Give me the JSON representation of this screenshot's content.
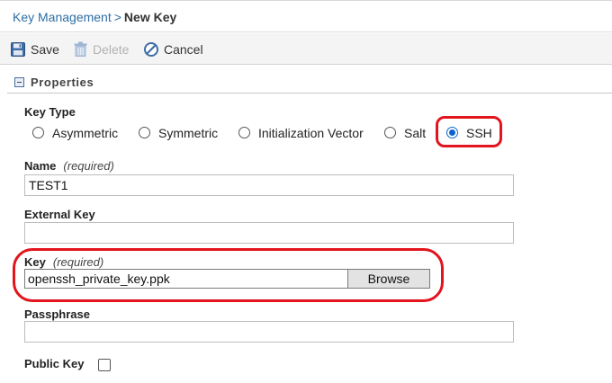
{
  "breadcrumb": {
    "parent": "Key Management",
    "separator": ">",
    "current": "New Key"
  },
  "toolbar": {
    "save": {
      "label": "Save",
      "icon": "floppy-disk-icon",
      "enabled": true
    },
    "delete": {
      "label": "Delete",
      "icon": "trash-icon",
      "enabled": false
    },
    "cancel": {
      "label": "Cancel",
      "icon": "cancel-circle-icon",
      "enabled": true
    }
  },
  "section": {
    "title": "Properties",
    "collapsed": false,
    "icon": "collapse-minus-icon"
  },
  "form": {
    "key_type": {
      "label": "Key Type",
      "options": [
        {
          "label": "Asymmetric",
          "checked": false
        },
        {
          "label": "Symmetric",
          "checked": false
        },
        {
          "label": "Initialization Vector",
          "checked": false
        },
        {
          "label": "Salt",
          "checked": false
        },
        {
          "label": "SSH",
          "checked": true
        }
      ]
    },
    "name": {
      "label": "Name",
      "required_note": "(required)",
      "value": "TEST1"
    },
    "external_key": {
      "label": "External Key",
      "value": ""
    },
    "key": {
      "label": "Key",
      "required_note": "(required)",
      "value": "openssh_private_key.ppk",
      "browse_label": "Browse"
    },
    "passphrase": {
      "label": "Passphrase",
      "value": ""
    },
    "public_key": {
      "label": "Public Key",
      "checked": false
    }
  },
  "colors": {
    "link": "#2d6ea5",
    "toolbar_bg": "#f4f4f4",
    "radio_selected": "#0b62cc",
    "annotation_red": "#e2141d"
  }
}
